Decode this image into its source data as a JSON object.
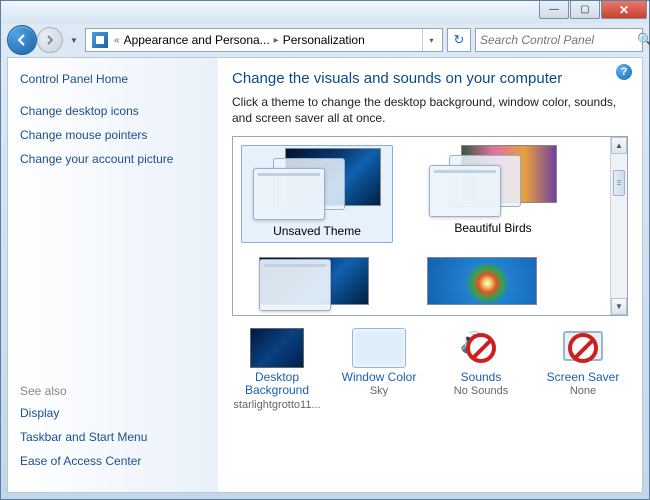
{
  "window": {
    "min": "—",
    "max": "▢",
    "close": "✕"
  },
  "address": {
    "prefix": "«",
    "seg1": "Appearance and Persona...",
    "seg2": "Personalization"
  },
  "search": {
    "placeholder": "Search Control Panel"
  },
  "sidebar": {
    "home": "Control Panel Home",
    "links": [
      "Change desktop icons",
      "Change mouse pointers",
      "Change your account picture"
    ],
    "see_also_hdr": "See also",
    "see_also": [
      "Display",
      "Taskbar and Start Menu",
      "Ease of Access Center"
    ]
  },
  "main": {
    "heading": "Change the visuals and sounds on your computer",
    "subhead": "Click a theme to change the desktop background, window color, sounds, and screen saver all at once.",
    "themes": [
      {
        "label": "Unsaved Theme"
      },
      {
        "label": "Beautiful Birds"
      }
    ],
    "bottom": {
      "dbg": {
        "label": "Desktop Background",
        "sub": "starlightgrotto11..."
      },
      "wc": {
        "label": "Window Color",
        "sub": "Sky"
      },
      "snd": {
        "label": "Sounds",
        "sub": "No Sounds"
      },
      "ss": {
        "label": "Screen Saver",
        "sub": "None"
      }
    }
  }
}
